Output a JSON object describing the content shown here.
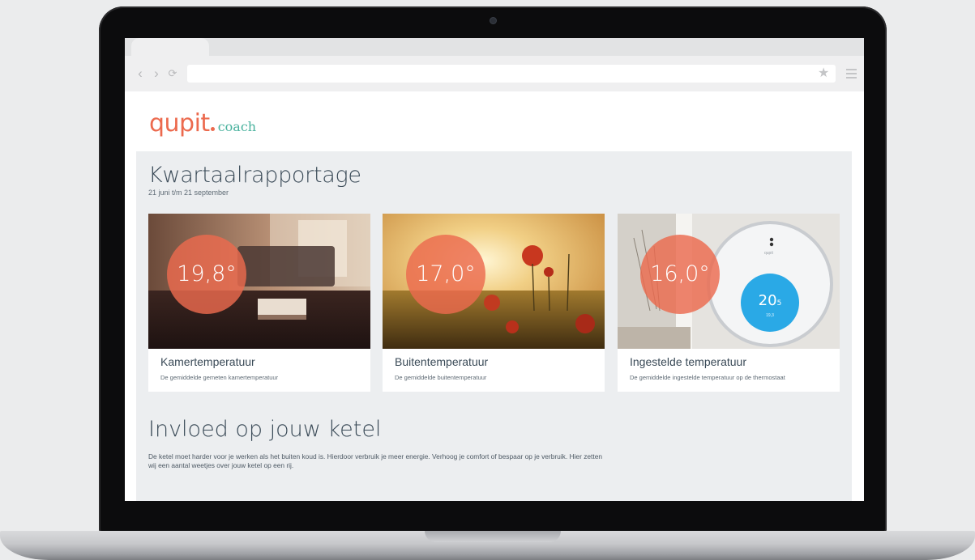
{
  "app": {
    "logo_main": "qupit",
    "logo_sub": "coach"
  },
  "report": {
    "title": "Kwartaalrapportage",
    "period": "21 juni t/m 21 september"
  },
  "cards": [
    {
      "value": "19,8°",
      "title": "Kamertemperatuur",
      "description": "De gemiddelde gemeten kamertemperatuur"
    },
    {
      "value": "17,0°",
      "title": "Buitentemperatuur",
      "description": "De gemiddelde buitentemperatuur"
    },
    {
      "value": "16,0°",
      "title": "Ingestelde temperatuur",
      "description": "De gemiddelde ingestelde temperatuur op de thermostaat"
    }
  ],
  "thermostat": {
    "brand": "qupit",
    "reading": "20",
    "reading_decimal": "5",
    "sub_reading": "19,3"
  },
  "influence": {
    "title": "Invloed op jouw ketel",
    "text": "De ketel moet harder voor je werken als het buiten koud is. Hierdoor verbruik je meer energie. Verhoog je comfort of bespaar op je verbruik. Hier zetten wij een aantal weetjes over jouw ketel op een rij."
  },
  "colors": {
    "accent": "#ec6a4e",
    "brand_secondary": "#4ab29e",
    "panel_bg": "#eceef0",
    "heading": "#3a4a57",
    "thermostat_screen": "#2aa9e6"
  },
  "icons": {
    "back": "chevron-left-icon",
    "forward": "chevron-right-icon",
    "reload": "reload-icon",
    "bookmark": "star-icon",
    "menu": "hamburger-menu-icon"
  }
}
